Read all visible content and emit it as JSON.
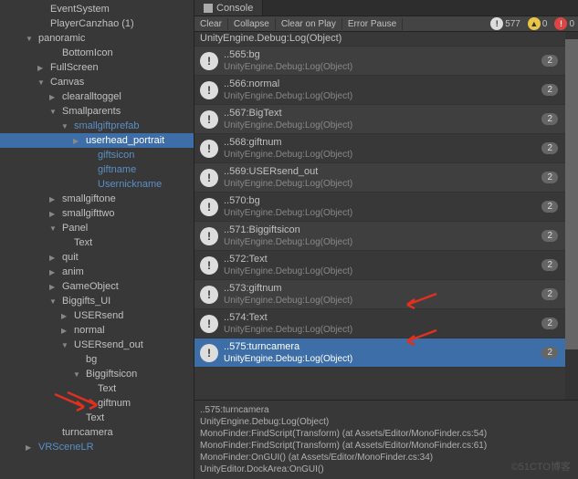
{
  "hierarchy": [
    {
      "label": "EventSystem",
      "indent": 3,
      "toggle": ""
    },
    {
      "label": "PlayerCanzhao (1)",
      "indent": 3,
      "toggle": ""
    },
    {
      "label": "panoramic",
      "indent": 2,
      "toggle": "▼"
    },
    {
      "label": "BottomIcon",
      "indent": 4,
      "toggle": ""
    },
    {
      "label": "FullScreen",
      "indent": 3,
      "toggle": "▶"
    },
    {
      "label": "Canvas",
      "indent": 3,
      "toggle": "▼"
    },
    {
      "label": "clearalltoggel",
      "indent": 4,
      "toggle": "▶"
    },
    {
      "label": "Smallparents",
      "indent": 4,
      "toggle": "▼"
    },
    {
      "label": "smallgiftprefab",
      "indent": 5,
      "toggle": "▼",
      "blue": true
    },
    {
      "label": "userhead_portrait",
      "indent": 6,
      "toggle": "▶",
      "selected": true
    },
    {
      "label": "giftsicon",
      "indent": 7,
      "toggle": "",
      "blue": true
    },
    {
      "label": "giftname",
      "indent": 7,
      "toggle": "",
      "blue": true
    },
    {
      "label": "Usernickname",
      "indent": 7,
      "toggle": "",
      "blue": true
    },
    {
      "label": "smallgiftone",
      "indent": 4,
      "toggle": "▶"
    },
    {
      "label": "smallgifttwo",
      "indent": 4,
      "toggle": "▶"
    },
    {
      "label": "Panel",
      "indent": 4,
      "toggle": "▼"
    },
    {
      "label": "Text",
      "indent": 5,
      "toggle": ""
    },
    {
      "label": "quit",
      "indent": 4,
      "toggle": "▶"
    },
    {
      "label": "anim",
      "indent": 4,
      "toggle": "▶"
    },
    {
      "label": "GameObject",
      "indent": 4,
      "toggle": "▶"
    },
    {
      "label": "Biggifts_UI",
      "indent": 4,
      "toggle": "▼"
    },
    {
      "label": "USERsend",
      "indent": 5,
      "toggle": "▶"
    },
    {
      "label": "normal",
      "indent": 5,
      "toggle": "▶"
    },
    {
      "label": "USERsend_out",
      "indent": 5,
      "toggle": "▼"
    },
    {
      "label": "bg",
      "indent": 6,
      "toggle": ""
    },
    {
      "label": "Biggiftsicon",
      "indent": 6,
      "toggle": "▼"
    },
    {
      "label": "Text",
      "indent": 7,
      "toggle": ""
    },
    {
      "label": "giftnum",
      "indent": 7,
      "toggle": ""
    },
    {
      "label": "Text",
      "indent": 6,
      "toggle": ""
    },
    {
      "label": "turncamera",
      "indent": 4,
      "toggle": ""
    },
    {
      "label": "VRSceneLR",
      "indent": 2,
      "toggle": "▶",
      "blue": true
    }
  ],
  "console": {
    "tab": "Console",
    "toolbar": {
      "clear": "Clear",
      "collapse": "Collapse",
      "clearOnPlay": "Clear on Play",
      "errorPause": "Error Pause",
      "counts": {
        "info": "577",
        "warn": "0",
        "err": "0"
      }
    },
    "items": [
      {
        "l1": "UnityEngine.Debug:Log(Object)",
        "l2": "",
        "badge": "",
        "half": true
      },
      {
        "l1": "..565:bg",
        "l2": "UnityEngine.Debug:Log(Object)",
        "badge": "2"
      },
      {
        "l1": "..566:normal",
        "l2": "UnityEngine.Debug:Log(Object)",
        "badge": "2"
      },
      {
        "l1": "..567:BigText",
        "l2": "UnityEngine.Debug:Log(Object)",
        "badge": "2"
      },
      {
        "l1": "..568:giftnum",
        "l2": "UnityEngine.Debug:Log(Object)",
        "badge": "2"
      },
      {
        "l1": "..569:USERsend_out",
        "l2": "UnityEngine.Debug:Log(Object)",
        "badge": "2"
      },
      {
        "l1": "..570:bg",
        "l2": "UnityEngine.Debug:Log(Object)",
        "badge": "2"
      },
      {
        "l1": "..571:Biggiftsicon",
        "l2": "UnityEngine.Debug:Log(Object)",
        "badge": "2"
      },
      {
        "l1": "..572:Text",
        "l2": "UnityEngine.Debug:Log(Object)",
        "badge": "2"
      },
      {
        "l1": "..573:giftnum",
        "l2": "UnityEngine.Debug:Log(Object)",
        "badge": "2"
      },
      {
        "l1": "..574:Text",
        "l2": "UnityEngine.Debug:Log(Object)",
        "badge": "2"
      },
      {
        "l1": "..575:turncamera",
        "l2": "UnityEngine.Debug:Log(Object)",
        "badge": "2",
        "sel": true
      }
    ],
    "detail": "..575:turncamera\nUnityEngine.Debug:Log(Object)\nMonoFinder:FindScript(Transform) (at Assets/Editor/MonoFinder.cs:54)\nMonoFinder:FindScript(Transform) (at Assets/Editor/MonoFinder.cs:61)\nMonoFinder:OnGUI() (at Assets/Editor/MonoFinder.cs:34)\nUnityEditor.DockArea:OnGUI()"
  },
  "watermark": "©51CTO博客"
}
